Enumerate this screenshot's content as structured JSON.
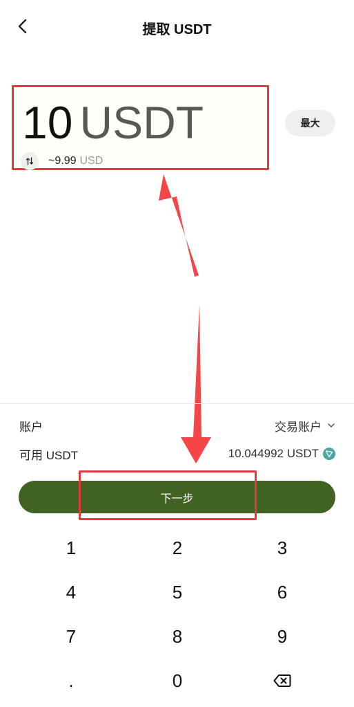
{
  "header": {
    "title": "提取 USDT",
    "back_icon": "chevron-left-icon"
  },
  "amount": {
    "value": "10",
    "unit": "USDT",
    "converted_value": "~9.99",
    "converted_unit": "USD",
    "swap_icon": "swap-arrows-icon"
  },
  "max_label": "最大",
  "account": {
    "label": "账户",
    "value": "交易账户",
    "dropdown_icon": "chevron-down-icon"
  },
  "available": {
    "label": "可用 USDT",
    "value": "10.044992 USDT",
    "token_icon": "tron-icon"
  },
  "next_label": "下一步",
  "keypad": {
    "keys": [
      "1",
      "2",
      "3",
      "4",
      "5",
      "6",
      "7",
      "8",
      "9",
      ".",
      "0"
    ],
    "backspace_icon": "backspace-icon"
  },
  "colors": {
    "accent": "#406321",
    "highlight": "#e5383b",
    "token": "#4aa8a0"
  }
}
